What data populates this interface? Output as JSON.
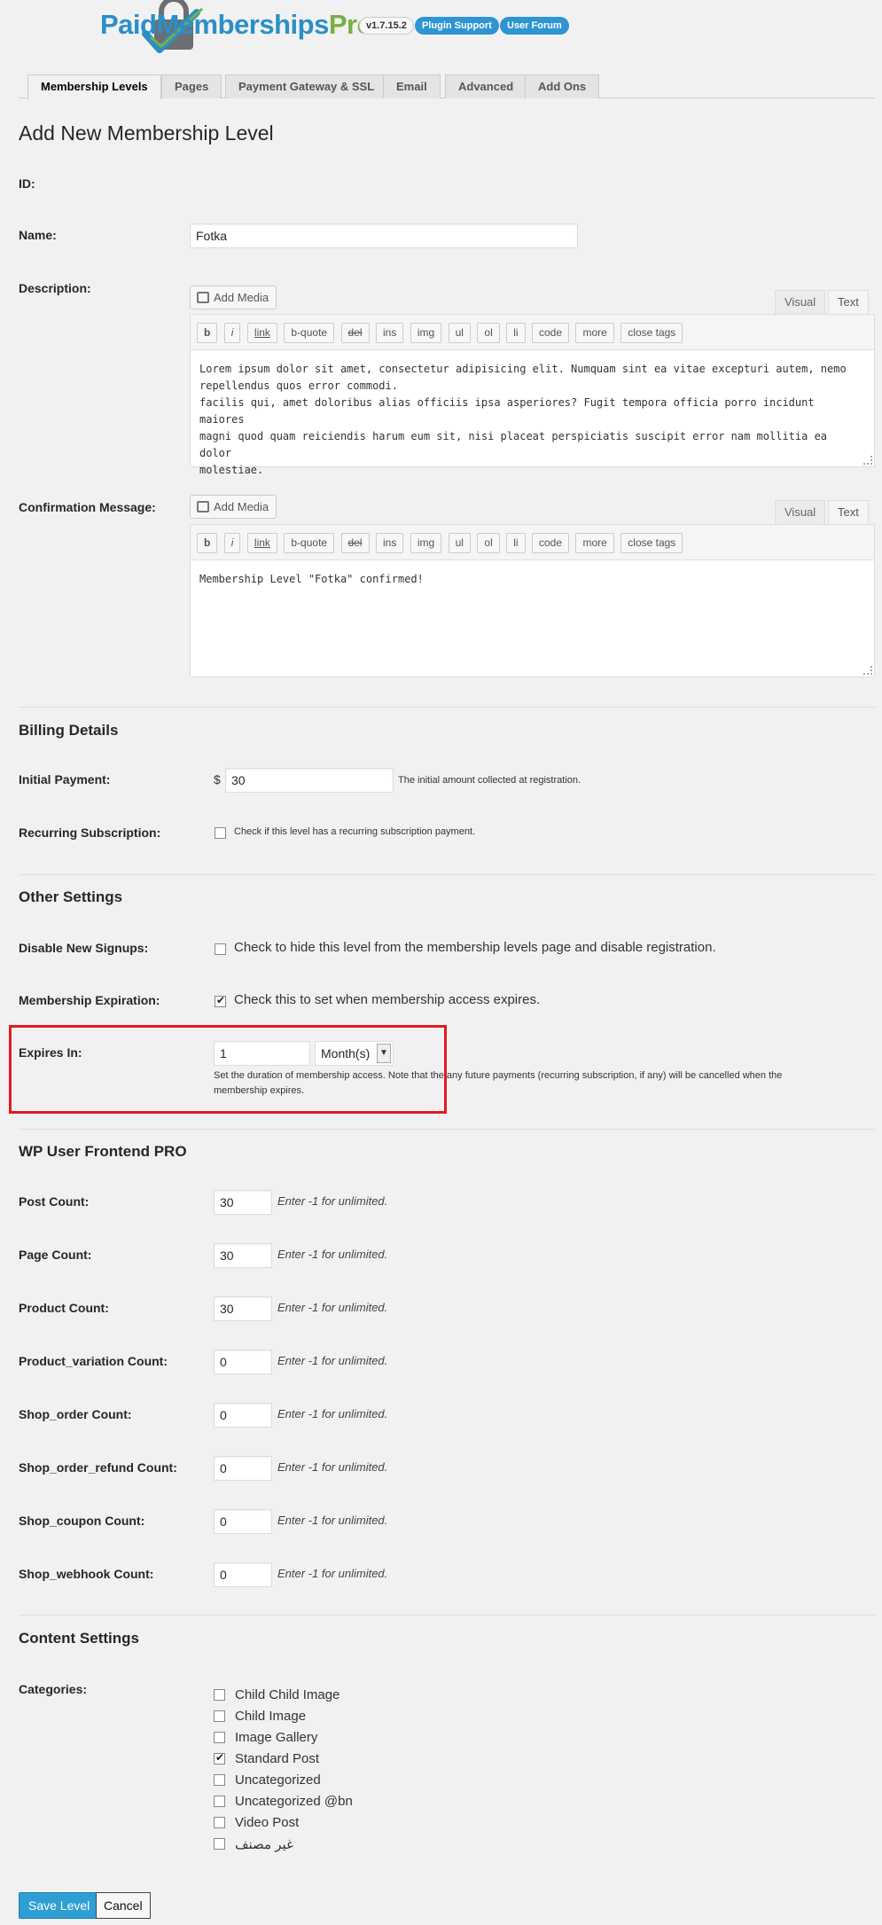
{
  "header": {
    "logo_part1": "Paid",
    "logo_part2": "Memberships",
    "logo_part3": "Pro",
    "version": "v1.7.15.2",
    "support_label": "Plugin Support",
    "forum_label": "User Forum"
  },
  "tabs": [
    "Membership Levels",
    "Pages",
    "Payment Gateway & SSL",
    "Email",
    "Advanced",
    "Add Ons"
  ],
  "page_title": "Add New Membership Level",
  "fields": {
    "id_label": "ID:",
    "name_label": "Name:",
    "name_value": "Fotka",
    "description_label": "Description:",
    "confirmation_label": "Confirmation Message:"
  },
  "editor": {
    "add_media": "Add Media",
    "visual": "Visual",
    "text": "Text",
    "buttons": [
      "b",
      "i",
      "link",
      "b-quote",
      "del",
      "ins",
      "img",
      "ul",
      "ol",
      "li",
      "code",
      "more",
      "close tags"
    ],
    "description_text": "Lorem ipsum dolor sit amet, consectetur adipisicing elit. Numquam sint ea vitae excepturi autem, nemo\nrepellendus quos error commodi.\nfacilis qui, amet doloribus alias officiis ipsa asperiores? Fugit tempora officia porro incidunt maiores\nmagni quod quam reiciendis harum eum sit, nisi placeat perspiciatis suscipit error nam mollitia ea dolor\nmolestiae.",
    "confirmation_text": "Membership Level \"Fotka\" confirmed!"
  },
  "billing": {
    "heading": "Billing Details",
    "initial_label": "Initial Payment:",
    "currency": "$",
    "initial_value": "30",
    "initial_hint": "The initial amount collected at registration.",
    "recurring_label": "Recurring Subscription:",
    "recurring_hint": "Check if this level has a recurring subscription payment."
  },
  "other": {
    "heading": "Other Settings",
    "disable_label": "Disable New Signups:",
    "disable_hint": "Check to hide this level from the membership levels page and disable registration.",
    "expiration_label": "Membership Expiration:",
    "expiration_hint": "Check this to set when membership access expires.",
    "expires_label": "Expires In:",
    "expires_value": "1",
    "expires_unit": "Month(s)",
    "expires_hint_1": "Set the duration of membership access. Note that the any future payments (recurring subscription, if any) will be cancelled when the",
    "expires_hint_2": "membership expires."
  },
  "wpuf": {
    "heading": "WP User Frontend PRO",
    "hint": "Enter -1 for unlimited.",
    "rows": [
      {
        "label": "Post Count:",
        "value": "30"
      },
      {
        "label": "Page Count:",
        "value": "30"
      },
      {
        "label": "Product Count:",
        "value": "30"
      },
      {
        "label": "Product_variation Count:",
        "value": "0"
      },
      {
        "label": "Shop_order Count:",
        "value": "0"
      },
      {
        "label": "Shop_order_refund Count:",
        "value": "0"
      },
      {
        "label": "Shop_coupon Count:",
        "value": "0"
      },
      {
        "label": "Shop_webhook Count:",
        "value": "0"
      }
    ]
  },
  "content": {
    "heading": "Content Settings",
    "categories_label": "Categories:",
    "categories": [
      {
        "name": "Child Child Image",
        "checked": false
      },
      {
        "name": "Child Image",
        "checked": false
      },
      {
        "name": "Image Gallery",
        "checked": false
      },
      {
        "name": "Standard Post",
        "checked": true
      },
      {
        "name": "Uncategorized",
        "checked": false
      },
      {
        "name": "Uncategorized @bn",
        "checked": false
      },
      {
        "name": "Video Post",
        "checked": false
      },
      {
        "name": "غير مصنف",
        "checked": false
      }
    ]
  },
  "actions": {
    "save": "Save Level",
    "cancel": "Cancel"
  },
  "colors": {
    "accent": "#2e95d3",
    "highlight": "#e11b22"
  }
}
